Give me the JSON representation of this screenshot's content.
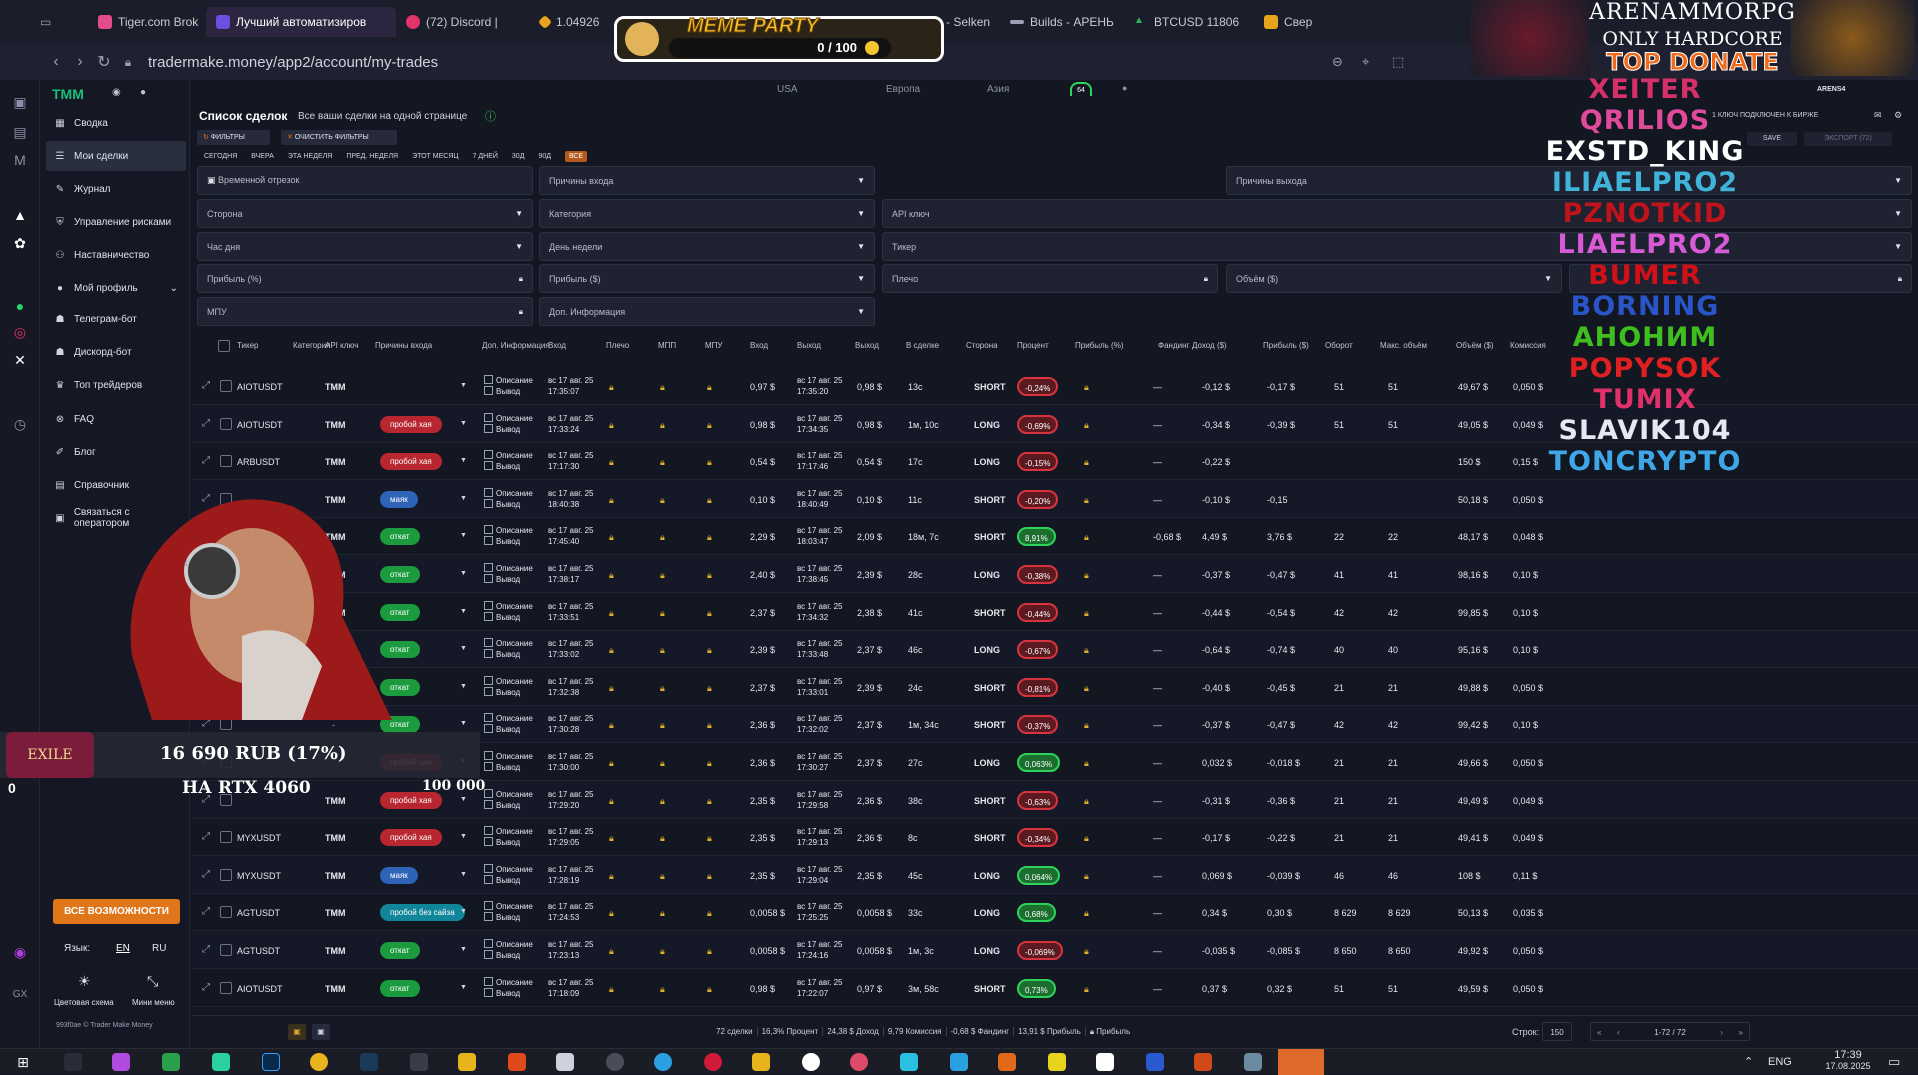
{
  "browser": {
    "tabs": [
      {
        "label": "Tiger.com Brok",
        "color": "#e24c8a"
      },
      {
        "label": "Лучший автоматизиров",
        "color": "#6c4ee0",
        "active": true
      },
      {
        "label": "(72) Discord |",
        "color": "#e2336a"
      },
      {
        "label": "1.04926",
        "color": "#e8a41c"
      },
      {
        "label": "Builds - Selken",
        "color": "#9aa0b2"
      },
      {
        "label": "Builds - АРЕНЬ",
        "color": "#9aa0b2"
      },
      {
        "label": "BTCUSD 11806",
        "color": "#29b35c"
      },
      {
        "label": "Свер",
        "color": "#e8a41c"
      }
    ],
    "url": "tradermake.money/app2/account/my-trades"
  },
  "meme_party": {
    "title": "MEME PARTY",
    "progress": "0 / 100"
  },
  "stream": {
    "title_line1": "ARENAMMORPG",
    "title_line2": "ONLY HARDCORE",
    "title_line3": "TOP DONATE",
    "donate_amount": "16 690 RUB (17%)",
    "donate_goal": "НА RTX 4060",
    "donate_target": "100 000",
    "donate_left": "0",
    "nicknames": [
      {
        "name": "XEITER",
        "color": "#d6306a"
      },
      {
        "name": "QRILIOS",
        "color": "#e04a9a"
      },
      {
        "name": "EXSTD_KING",
        "color": "#ffffff"
      },
      {
        "name": "ILIAELPRO2",
        "color": "#3fb4d8"
      },
      {
        "name": "PZNOTKID",
        "color": "#c0141c"
      },
      {
        "name": "LIAELPRO2",
        "color": "#d85ad6"
      },
      {
        "name": "BUMER",
        "color": "#d21018"
      },
      {
        "name": "BORNING",
        "color": "#2a55c8"
      },
      {
        "name": "АНОНИМ",
        "color": "#3fbf1e"
      },
      {
        "name": "POPYSOK",
        "color": "#e02020"
      },
      {
        "name": "TUMIX",
        "color": "#e0306a"
      },
      {
        "name": "SLAVIK104",
        "color": "#e8e8f2"
      },
      {
        "name": "TONCRYPTO",
        "color": "#3fa6e8"
      }
    ]
  },
  "topbar": {
    "regions": [
      "USA",
      "Европа",
      "Азия"
    ],
    "badge": "64",
    "account": "ARENS4",
    "api_status": "1 КЛЮЧ ПОДКЛЮЧЕН К БИРЖЕ",
    "save": "SAVE",
    "export": "ЭКСПОРТ (72)"
  },
  "sidebar": {
    "items": [
      {
        "label": "Сводка",
        "icon": "dashboard-icon"
      },
      {
        "label": "Мои сделки",
        "icon": "list-icon",
        "active": true
      },
      {
        "label": "Журнал",
        "icon": "journal-icon"
      },
      {
        "label": "Управление рисками",
        "icon": "shield-icon"
      },
      {
        "label": "Наставничество",
        "icon": "people-icon"
      },
      {
        "label": "Мой профиль",
        "icon": "user-icon"
      },
      {
        "label": "Телеграм-бот",
        "icon": "telegram-icon"
      },
      {
        "label": "Дискорд-бот",
        "icon": "discord-icon"
      },
      {
        "label": "Топ трейдеров",
        "icon": "trophy-icon"
      },
      {
        "label": "FAQ",
        "icon": "faq-icon"
      },
      {
        "label": "Блог",
        "icon": "blog-icon"
      },
      {
        "label": "Справочник",
        "icon": "book-icon"
      },
      {
        "label": "Связаться с оператором",
        "icon": "chat-icon"
      }
    ],
    "all_features": "ВСЕ ВОЗМОЖНОСТИ",
    "lang_label": "Язык:",
    "lang_en": "EN",
    "lang_ru": "RU",
    "color_scheme": "Цветовая схема",
    "mini_menu": "Мини меню",
    "copyright": "993f0ae © Trader Make Money"
  },
  "page": {
    "title": "Список сделок",
    "subtitle": "Все ваши сделки на одной странице",
    "filters_btn": "ФИЛЬТРЫ",
    "clear_btn": "ОЧИСТИТЬ ФИЛЬТРЫ",
    "periods": [
      "СЕГОДНЯ",
      "ВЧЕРА",
      "ЭТА НЕДЕЛЯ",
      "ПРЕД. НЕДЕЛЯ",
      "ЭТОТ МЕСЯЦ",
      "7 ДНЕЙ",
      "30Д",
      "90Д",
      "ВСЕ"
    ],
    "filters": {
      "time_period": "Временной отрезок",
      "entry_reasons": "Причины входа",
      "exit_reasons": "Причины выхода",
      "side": "Сторона",
      "category": "Категория",
      "api_key": "API ключ",
      "hour": "Час дня",
      "weekday": "День недели",
      "ticker": "Тикер",
      "profit_pct": "Прибыль (%)",
      "profit_usd": "Прибыль ($)",
      "leverage": "Плечо",
      "volume": "Объём ($)",
      "mpu": "МПУ",
      "extra_info": "Доп. Информация"
    }
  },
  "table": {
    "headers": [
      "Тикер",
      "Категория",
      "API ключ",
      "Причины входа",
      "Доп. Информация",
      "Вход",
      "Плечо",
      "МПП",
      "МПУ",
      "Вход",
      "Выход",
      "Выход",
      "В сделке",
      "Сторона",
      "Процент",
      "Прибыль (%)",
      "Фандинг",
      "Доход ($)",
      "Прибыль ($)",
      "Оборот",
      "Макс. объём",
      "Объём ($)",
      "Комиссия"
    ],
    "desc_label": "Описание",
    "exit_label": "Вывод",
    "rows": [
      {
        "ticker": "AIOTUSDT",
        "api": "TMM",
        "reason": "",
        "rcolor": "",
        "entry_dt": [
          "вс 17 авг. 25",
          "17:35:07"
        ],
        "entry": "0,97 $",
        "exit_dt": [
          "вс 17 авг. 25",
          "17:35:20"
        ],
        "exit": "0,98 $",
        "dur": "13с",
        "side": "SHORT",
        "pct": "-0,24%",
        "funding": "—",
        "income": "-0,12 $",
        "profit": "-0,17 $",
        "turnover": "51",
        "maxvol": "51",
        "vol": "49,67 $",
        "fee": "0,050 $"
      },
      {
        "ticker": "AIOTUSDT",
        "api": "TMM",
        "reason": "пробой хая",
        "rcolor": "red",
        "entry_dt": [
          "вс 17 авг. 25",
          "17:33:24"
        ],
        "entry": "0,98 $",
        "exit_dt": [
          "вс 17 авг. 25",
          "17:34:35"
        ],
        "exit": "0,98 $",
        "dur": "1м, 10с",
        "side": "LONG",
        "pct": "-0,69%",
        "funding": "—",
        "income": "-0,34 $",
        "profit": "-0,39 $",
        "turnover": "51",
        "maxvol": "51",
        "vol": "49,05 $",
        "fee": "0,049 $"
      },
      {
        "ticker": "ARBUSDT",
        "api": "TMM",
        "reason": "пробой хая",
        "rcolor": "red",
        "entry_dt": [
          "вс 17 авг. 25",
          "17:17:30"
        ],
        "entry": "0,54 $",
        "exit_dt": [
          "вс 17 авг. 25",
          "17:17:46"
        ],
        "exit": "0,54 $",
        "dur": "17с",
        "side": "LONG",
        "pct": "-0,15%",
        "funding": "—",
        "income": "-0,22 $",
        "profit": "",
        "turnover": "",
        "maxvol": "",
        "vol": "150 $",
        "fee": "0,15 $"
      },
      {
        "ticker": "",
        "api": "TMM",
        "reason": "маяк",
        "rcolor": "blue",
        "entry_dt": [
          "вс 17 авг. 25",
          "18:40:38"
        ],
        "entry": "0,10 $",
        "exit_dt": [
          "вс 17 авг. 25",
          "18:40:49"
        ],
        "exit": "0,10 $",
        "dur": "11с",
        "side": "SHORT",
        "pct": "-0,20%",
        "funding": "—",
        "income": "-0,10 $",
        "profit": "-0,15",
        "turnover": "",
        "maxvol": "",
        "vol": "50,18 $",
        "fee": "0,050 $"
      },
      {
        "ticker": "",
        "api": "TMM",
        "reason": "откат",
        "rcolor": "green",
        "entry_dt": [
          "вс 17 авг. 25",
          "17:45:40"
        ],
        "entry": "2,29 $",
        "exit_dt": [
          "вс 17 авг. 25",
          "18:03:47"
        ],
        "exit": "2,09 $",
        "dur": "18м, 7с",
        "side": "SHORT",
        "pct": "8,91%",
        "funding": "-0,68 $",
        "income": "4,49 $",
        "profit": "3,76 $",
        "turnover": "22",
        "maxvol": "22",
        "vol": "48,17 $",
        "fee": "0,048 $"
      },
      {
        "ticker": "",
        "api": "TMM",
        "reason": "откат",
        "rcolor": "green",
        "entry_dt": [
          "вс 17 авг. 25",
          "17:38:17"
        ],
        "entry": "2,40 $",
        "exit_dt": [
          "вс 17 авг. 25",
          "17:38:45"
        ],
        "exit": "2,39 $",
        "dur": "28с",
        "side": "LONG",
        "pct": "-0,38%",
        "funding": "—",
        "income": "-0,37 $",
        "profit": "-0,47 $",
        "turnover": "41",
        "maxvol": "41",
        "vol": "98,16 $",
        "fee": "0,10 $"
      },
      {
        "ticker": "",
        "api": "TMM",
        "reason": "откат",
        "rcolor": "green",
        "entry_dt": [
          "вс 17 авг. 25",
          "17:33:51"
        ],
        "entry": "2,37 $",
        "exit_dt": [
          "вс 17 авг. 25",
          "17:34:32"
        ],
        "exit": "2,38 $",
        "dur": "41с",
        "side": "SHORT",
        "pct": "-0,44%",
        "funding": "—",
        "income": "-0,44 $",
        "profit": "-0,54 $",
        "turnover": "42",
        "maxvol": "42",
        "vol": "99,85 $",
        "fee": "0,10 $"
      },
      {
        "ticker": "",
        "api": "",
        "reason": "откат",
        "rcolor": "green",
        "entry_dt": [
          "вс 17 авг. 25",
          "17:33:02"
        ],
        "entry": "2,39 $",
        "exit_dt": [
          "вс 17 авг. 25",
          "17:33:48"
        ],
        "exit": "2,37 $",
        "dur": "46с",
        "side": "LONG",
        "pct": "-0,67%",
        "funding": "—",
        "income": "-0,64 $",
        "profit": "-0,74 $",
        "turnover": "40",
        "maxvol": "40",
        "vol": "95,16 $",
        "fee": "0,10 $"
      },
      {
        "ticker": "",
        "api": "",
        "reason": "откат",
        "rcolor": "green",
        "entry_dt": [
          "вс 17 авг. 25",
          "17:32:38"
        ],
        "entry": "2,37 $",
        "exit_dt": [
          "вс 17 авг. 25",
          "17:33:01"
        ],
        "exit": "2,39 $",
        "dur": "24с",
        "side": "SHORT",
        "pct": "-0,81%",
        "funding": "—",
        "income": "-0,40 $",
        "profit": "-0,45 $",
        "turnover": "21",
        "maxvol": "21",
        "vol": "49,88 $",
        "fee": "0,050 $"
      },
      {
        "ticker": "",
        "api": "",
        "reason": "откат",
        "rcolor": "green",
        "entry_dt": [
          "вс 17 авг. 25",
          "17:30:28"
        ],
        "entry": "2,36 $",
        "exit_dt": [
          "вс 17 авг. 25",
          "17:32:02"
        ],
        "exit": "2,37 $",
        "dur": "1м, 34с",
        "side": "SHORT",
        "pct": "-0,37%",
        "funding": "—",
        "income": "-0,37 $",
        "profit": "-0,47 $",
        "turnover": "42",
        "maxvol": "42",
        "vol": "99,42 $",
        "fee": "0,10 $"
      },
      {
        "ticker": "",
        "api": "",
        "reason": "пробой хая",
        "rcolor": "red",
        "entry_dt": [
          "вс 17 авг. 25",
          "17:30:00"
        ],
        "entry": "2,36 $",
        "exit_dt": [
          "вс 17 авг. 25",
          "17:30:27"
        ],
        "exit": "2,37 $",
        "dur": "27с",
        "side": "LONG",
        "pct": "0,063%",
        "funding": "—",
        "income": "0,032 $",
        "profit": "-0,018 $",
        "turnover": "21",
        "maxvol": "21",
        "vol": "49,66 $",
        "fee": "0,050 $"
      },
      {
        "ticker": "",
        "api": "TMM",
        "reason": "пробой хая",
        "rcolor": "red",
        "entry_dt": [
          "вс 17 авг. 25",
          "17:29:20"
        ],
        "entry": "2,35 $",
        "exit_dt": [
          "вс 17 авг. 25",
          "17:29:58"
        ],
        "exit": "2,36 $",
        "dur": "38с",
        "side": "SHORT",
        "pct": "-0,63%",
        "funding": "—",
        "income": "-0,31 $",
        "profit": "-0,36 $",
        "turnover": "21",
        "maxvol": "21",
        "vol": "49,49 $",
        "fee": "0,049 $"
      },
      {
        "ticker": "MYXUSDT",
        "api": "TMM",
        "reason": "пробой хая",
        "rcolor": "red",
        "entry_dt": [
          "вс 17 авг. 25",
          "17:29:05"
        ],
        "entry": "2,35 $",
        "exit_dt": [
          "вс 17 авг. 25",
          "17:29:13"
        ],
        "exit": "2,36 $",
        "dur": "8с",
        "side": "SHORT",
        "pct": "-0,34%",
        "funding": "—",
        "income": "-0,17 $",
        "profit": "-0,22 $",
        "turnover": "21",
        "maxvol": "21",
        "vol": "49,41 $",
        "fee": "0,049 $"
      },
      {
        "ticker": "MYXUSDT",
        "api": "TMM",
        "reason": "маяк",
        "rcolor": "blue",
        "entry_dt": [
          "вс 17 авг. 25",
          "17:28:19"
        ],
        "entry": "2,35 $",
        "exit_dt": [
          "вс 17 авг. 25",
          "17:29:04"
        ],
        "exit": "2,35 $",
        "dur": "45с",
        "side": "LONG",
        "pct": "0,064%",
        "funding": "—",
        "income": "0,069 $",
        "profit": "-0,039 $",
        "turnover": "46",
        "maxvol": "46",
        "vol": "108 $",
        "fee": "0,11 $"
      },
      {
        "ticker": "AGTUSDT",
        "api": "TMM",
        "reason": "пробой без сайза",
        "rcolor": "teal",
        "entry_dt": [
          "вс 17 авг. 25",
          "17:24:53"
        ],
        "entry": "0,0058 $",
        "exit_dt": [
          "вс 17 авг. 25",
          "17:25:25"
        ],
        "exit": "0,0058 $",
        "dur": "33с",
        "side": "LONG",
        "pct": "0,68%",
        "funding": "—",
        "income": "0,34 $",
        "profit": "0,30 $",
        "turnover": "8 629",
        "maxvol": "8 629",
        "vol": "50,13 $",
        "fee": "0,035 $"
      },
      {
        "ticker": "AGTUSDT",
        "api": "TMM",
        "reason": "откат",
        "rcolor": "green",
        "entry_dt": [
          "вс 17 авг. 25",
          "17:23:13"
        ],
        "entry": "0,0058 $",
        "exit_dt": [
          "вс 17 авг. 25",
          "17:24:16"
        ],
        "exit": "0,0058 $",
        "dur": "1м, 3с",
        "side": "LONG",
        "pct": "-0,069%",
        "funding": "—",
        "income": "-0,035 $",
        "profit": "-0,085 $",
        "turnover": "8 650",
        "maxvol": "8 650",
        "vol": "49,92 $",
        "fee": "0,050 $"
      },
      {
        "ticker": "AIOTUSDT",
        "api": "TMM",
        "reason": "откат",
        "rcolor": "green",
        "entry_dt": [
          "вс 17 авг. 25",
          "17:18:09"
        ],
        "entry": "0,98 $",
        "exit_dt": [
          "вс 17 авг. 25",
          "17:22:07"
        ],
        "exit": "0,97 $",
        "dur": "3м, 58с",
        "side": "SHORT",
        "pct": "0,73%",
        "funding": "—",
        "income": "0,37 $",
        "profit": "0,32 $",
        "turnover": "51",
        "maxvol": "51",
        "vol": "49,59 $",
        "fee": "0,050 $"
      }
    ]
  },
  "footer": {
    "stats": [
      "72 сделки",
      "16,3% Процент",
      "24,38 $ Доход",
      "9,79 Комиссия",
      "-0,68 $ Фандинг",
      "13,91 $ Прибыль",
      "Прибыль"
    ],
    "rows_label": "Строк:",
    "rows_value": "150",
    "pagination": "1-72 / 72"
  },
  "taskbar": {
    "lang": "ENG",
    "time": "17:39",
    "date": "17.08.2025"
  }
}
